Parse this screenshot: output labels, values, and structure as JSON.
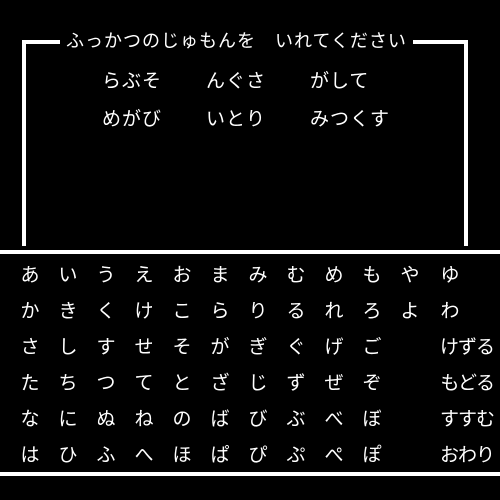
{
  "dialog": {
    "title": "ふっかつのじゅもんを　いれてください",
    "lines": [
      [
        "らぶそ",
        "んぐさ",
        "がして"
      ],
      [
        "めがび",
        "いとり",
        "みつくす"
      ]
    ]
  },
  "keyboard": {
    "rows": [
      [
        "あ",
        "い",
        "う",
        "え",
        "お",
        "ま",
        "み",
        "む",
        "め",
        "も",
        "や",
        "ゆ"
      ],
      [
        "か",
        "き",
        "く",
        "け",
        "こ",
        "ら",
        "り",
        "る",
        "れ",
        "ろ",
        "よ",
        "わ"
      ],
      [
        "さ",
        "し",
        "す",
        "せ",
        "そ",
        "が",
        "ぎ",
        "ぐ",
        "げ",
        "ご",
        "けずる"
      ],
      [
        "た",
        "ち",
        "つ",
        "て",
        "と",
        "ざ",
        "じ",
        "ず",
        "ぜ",
        "ぞ",
        "もどる"
      ],
      [
        "な",
        "に",
        "ぬ",
        "ね",
        "の",
        "ば",
        "び",
        "ぶ",
        "べ",
        "ぼ",
        "すすむ"
      ],
      [
        "は",
        "ひ",
        "ふ",
        "へ",
        "ほ",
        "ぱ",
        "ぴ",
        "ぷ",
        "ぺ",
        "ぽ",
        "おわり"
      ]
    ]
  },
  "colors": {
    "background": "#000000",
    "foreground": "#ffffff"
  }
}
